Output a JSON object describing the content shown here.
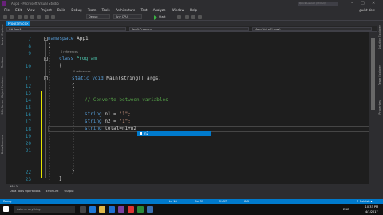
{
  "window": {
    "title": "App1 - Microsoft Visual Studio",
    "quick_launch": "Quick Launch (Ctrl+Q)",
    "user": "gulat daw"
  },
  "menu": [
    "File",
    "Edit",
    "View",
    "Project",
    "Build",
    "Debug",
    "Team",
    "Tools",
    "Architecture",
    "Test",
    "Analyze",
    "Window",
    "Help"
  ],
  "toolbar": {
    "config": "Debug",
    "platform": "Any CPU",
    "start_label": "Start"
  },
  "sidebar_left": [
    "Server Explorer",
    "Toolbox",
    "SQL Server Object Explorer",
    "Data Sources"
  ],
  "sidebar_right": [
    "Solution Explorer",
    "Team Explorer",
    "Properties"
  ],
  "tabs": [
    {
      "label": "Program.cs"
    }
  ],
  "nav": {
    "project": "C# App1",
    "class": "App1.Program",
    "member": "Main(string[] args)"
  },
  "editor": {
    "line_numbers": [
      "7",
      "8",
      "9",
      "10",
      "11",
      "12",
      "13",
      "14",
      "15",
      "16",
      "17",
      "18",
      "19",
      "20",
      "21",
      "22",
      "23"
    ],
    "ref_class": "0 references",
    "ref_main": "0 references",
    "namespace_kw": "namespace",
    "namespace_name": "App1",
    "class_kw": "class",
    "class_name": "Program",
    "main_static": "static",
    "main_void": "void",
    "main_sig": "Main(string[] args)",
    "comment": "// Converte between variables",
    "line16_kw": "string",
    "line16_var": "n1 =",
    "line16_val": "\"1\";",
    "line17_kw": "string",
    "line17_var": "n2 =",
    "line17_val": "\"1\";",
    "line18_kw": "string",
    "line18_rest": "total=n1+n2",
    "intellisense_item": "n2"
  },
  "zoom": "100 %",
  "bottom_tabs": [
    "Data Tools Operations",
    "Error List",
    "Output"
  ],
  "status": {
    "left": "Ready",
    "ln": "Ln 18",
    "col": "Col 37",
    "ch": "Ch 37",
    "mode": "INS",
    "publish": "↑ Publish ▴"
  },
  "taskbar": {
    "search_placeholder": "Ask me anything",
    "time": "10:33 PM",
    "date": "4/1/2017",
    "lang": "ENG"
  },
  "colors": {
    "accent": "#007acc",
    "keyword": "#569cd6",
    "type": "#4ec9b0",
    "comment": "#57a64a",
    "string": "#d69d85"
  }
}
